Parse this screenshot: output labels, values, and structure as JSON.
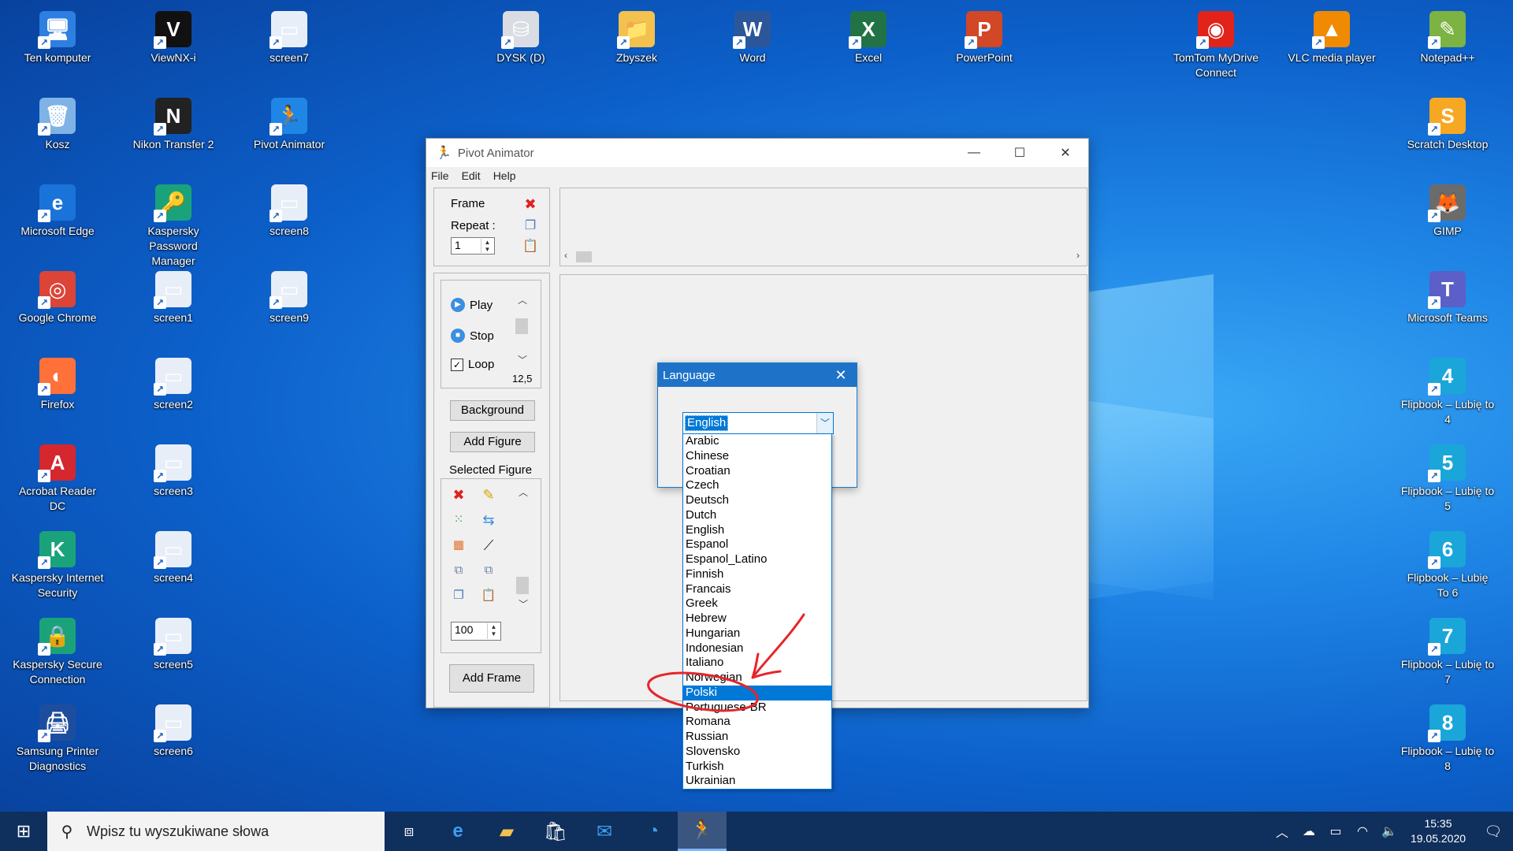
{
  "desktop": {
    "icons": [
      {
        "label": "Ten komputer",
        "glyph": "🖥",
        "color": "#2d7fe0"
      },
      {
        "label": "ViewNX-i",
        "glyph": "V",
        "color": "#111111"
      },
      {
        "label": "screen7",
        "glyph": "▭",
        "color": "#e8eef7"
      },
      {
        "label": "DYSK (D)",
        "glyph": "⛁",
        "color": "#d9dde3"
      },
      {
        "label": "Zbyszek",
        "glyph": "📁",
        "color": "#f2c14e"
      },
      {
        "label": "Word",
        "glyph": "W",
        "color": "#2b579a"
      },
      {
        "label": "Excel",
        "glyph": "X",
        "color": "#217346"
      },
      {
        "label": "PowerPoint",
        "glyph": "P",
        "color": "#d24726"
      },
      {
        "label": "TomTom MyDrive Connect",
        "glyph": "◉",
        "color": "#e2231a"
      },
      {
        "label": "VLC media player",
        "glyph": "▲",
        "color": "#f08a00"
      },
      {
        "label": "Notepad++",
        "glyph": "✎",
        "color": "#7cb342"
      },
      {
        "label": "Kosz",
        "glyph": "🗑",
        "color": "#7fb2e5"
      },
      {
        "label": "Nikon Transfer 2",
        "glyph": "N",
        "color": "#222222"
      },
      {
        "label": "Pivot Animator",
        "glyph": "🏃",
        "color": "#1f86e6"
      },
      {
        "label": "Scratch Desktop",
        "glyph": "S",
        "color": "#f7a823"
      },
      {
        "label": "Microsoft Edge",
        "glyph": "e",
        "color": "#1a73d8"
      },
      {
        "label": "Kaspersky Password Manager",
        "glyph": "🔑",
        "color": "#1aa37a"
      },
      {
        "label": "screen8",
        "glyph": "▭",
        "color": "#e8eef7"
      },
      {
        "label": "GIMP",
        "glyph": "🦊",
        "color": "#6b6b6b"
      },
      {
        "label": "Google Chrome",
        "glyph": "◎",
        "color": "#db4437"
      },
      {
        "label": "screen1",
        "glyph": "▭",
        "color": "#e8eef7"
      },
      {
        "label": "screen9",
        "glyph": "▭",
        "color": "#e8eef7"
      },
      {
        "label": "Microsoft Teams",
        "glyph": "T",
        "color": "#5b5fc7"
      },
      {
        "label": "Firefox",
        "glyph": "◐",
        "color": "#ff7139"
      },
      {
        "label": "screen2",
        "glyph": "▭",
        "color": "#e8eef7"
      },
      {
        "label": "Flipbook – Lubię to 4",
        "glyph": "4",
        "color": "#1aa6d9"
      },
      {
        "label": "Acrobat Reader DC",
        "glyph": "A",
        "color": "#d4272e"
      },
      {
        "label": "screen3",
        "glyph": "▭",
        "color": "#e8eef7"
      },
      {
        "label": "Flipbook – Lubię to 5",
        "glyph": "5",
        "color": "#1aa6d9"
      },
      {
        "label": "Kaspersky Internet Security",
        "glyph": "K",
        "color": "#1aa37a"
      },
      {
        "label": "screen4",
        "glyph": "▭",
        "color": "#e8eef7"
      },
      {
        "label": "Flipbook – Lubię To 6",
        "glyph": "6",
        "color": "#1aa6d9"
      },
      {
        "label": "Kaspersky Secure Connection",
        "glyph": "🔒",
        "color": "#1aa37a"
      },
      {
        "label": "screen5",
        "glyph": "▭",
        "color": "#e8eef7"
      },
      {
        "label": "Flipbook – Lubię to 7",
        "glyph": "7",
        "color": "#1aa6d9"
      },
      {
        "label": "Samsung Printer Diagnostics",
        "glyph": "🖨",
        "color": "#1d4e9e"
      },
      {
        "label": "screen6",
        "glyph": "▭",
        "color": "#e8eef7"
      },
      {
        "label": "Flipbook – Lubię to 8",
        "glyph": "8",
        "color": "#1aa6d9"
      }
    ]
  },
  "window": {
    "title": "Pivot Animator",
    "menu": [
      "File",
      "Edit",
      "Help"
    ],
    "frame_label": "Frame",
    "repeat_label": "Repeat :",
    "repeat_value": "1",
    "play_label": "Play",
    "stop_label": "Stop",
    "loop_label": "Loop",
    "speed_value": "12,5",
    "background_label": "Background",
    "add_figure_label": "Add Figure",
    "selected_figure_label": "Selected Figure",
    "figure_scale_value": "100",
    "add_frame_label": "Add Frame"
  },
  "dialog": {
    "title": "Language",
    "selected": "English",
    "options": [
      "Arabic",
      "Chinese",
      "Croatian",
      "Czech",
      "Deutsch",
      "Dutch",
      "English",
      "Espanol",
      "Espanol_Latino",
      "Finnish",
      "Francais",
      "Greek",
      "Hebrew",
      "Hungarian",
      "Indonesian",
      "Italiano",
      "Norwegian",
      "Polski",
      "Portuguese-BR",
      "Romana",
      "Russian",
      "Slovensko",
      "Turkish",
      "Ukrainian"
    ],
    "highlighted": "Polski"
  },
  "taskbar": {
    "search_placeholder": "Wpisz tu wyszukiwane słowa",
    "time": "15:35",
    "date": "19.05.2020"
  },
  "colors": {
    "accent": "#0078d7",
    "annotation": "#e5262a"
  }
}
